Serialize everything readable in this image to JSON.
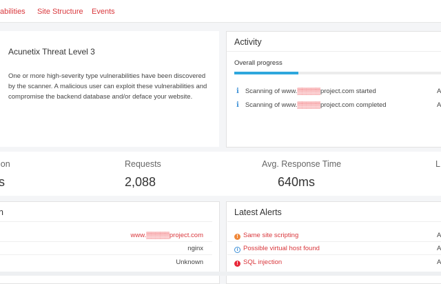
{
  "tabs": [
    {
      "label": "abilities"
    },
    {
      "label": "Site Structure"
    },
    {
      "label": "Events"
    }
  ],
  "threat": {
    "title": "Acunetix Threat Level 3",
    "description": "One or more high-severity type vulnerabilities have been discovered by the scanner. A malicious user can exploit these vulnerabilities and compromise the backend database and/or deface your website."
  },
  "activity": {
    "title": "Activity",
    "progress_label": "Overall progress",
    "progress_fraction": 0.31,
    "items": [
      {
        "prefix": "Scanning of www.",
        "redacted": "▒▒▒▒▒",
        "suffix": "project.com started",
        "right": "A"
      },
      {
        "prefix": "Scanning of www.",
        "redacted": "▒▒▒▒▒",
        "suffix": "project.com completed",
        "right": "A"
      }
    ]
  },
  "stats": [
    {
      "label": "ion",
      "value": "s"
    },
    {
      "label": "Requests",
      "value": "2,088"
    },
    {
      "label": "Avg. Response Time",
      "value": "640ms"
    },
    {
      "label": "L",
      "value": ""
    }
  ],
  "info": {
    "title": "n",
    "rows": [
      {
        "prefix": "www.",
        "redacted": "▒▒▒▒▒",
        "suffix": "project.com"
      },
      {
        "value": "nginx"
      },
      {
        "value": "Unknown"
      }
    ]
  },
  "alerts": {
    "title": "Latest Alerts",
    "items": [
      {
        "label": "Same site scripting",
        "severity_color": "#f0883a",
        "icon": "exclamation-icon",
        "right": "A"
      },
      {
        "label": "Possible virtual host found",
        "severity_color": "#3b8fd6",
        "icon": "info-icon",
        "right": "A"
      },
      {
        "label": "SQL injection",
        "severity_color": "#e8283a",
        "icon": "exclamation-icon",
        "right": "A"
      }
    ]
  }
}
